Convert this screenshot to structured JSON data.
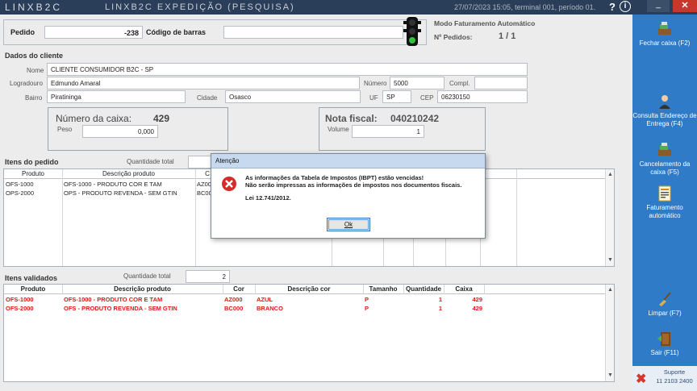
{
  "titlebar": {
    "brand": "LINXB2C",
    "title": "LINXB2C EXPEDIÇÃO (PESQUISA)",
    "status": "27/07/2023 15:05, terminal 001, período 01.",
    "help": "?",
    "info": "i",
    "minimize": "_",
    "close": "✕"
  },
  "header": {
    "pedido_label": "Pedido",
    "pedido_value": "-238",
    "codigo_label": "Código de barras",
    "codigo_value": "",
    "modo_label": "Modo Faturamento Automático",
    "npedidos_label": "Nº Pedidos:",
    "npedidos_value": "1 / 1"
  },
  "cliente": {
    "section": "Dados do cliente",
    "nome_label": "Nome",
    "nome_value": "CLIENTE CONSUMIDOR B2C - SP",
    "logradouro_label": "Logradouro",
    "logradouro_value": "Edmundo Amaral",
    "numero_label": "Número",
    "numero_value": "5000",
    "compl_label": "Compl.",
    "compl_value": "",
    "bairro_label": "Bairro",
    "bairro_value": "Piratininga",
    "cidade_label": "Cidade",
    "cidade_value": "Osasco",
    "uf_label": "UF",
    "uf_value": "SP",
    "cep_label": "CEP",
    "cep_value": "06230150"
  },
  "caixa": {
    "label": "Número da caixa:",
    "value": "429",
    "peso_label": "Peso",
    "peso_value": "0,000"
  },
  "nota": {
    "label": "Nota fiscal:",
    "value": "040210242",
    "volume_label": "Volume",
    "volume_value": "1"
  },
  "itens_pedido": {
    "section": "Itens do pedido",
    "qtd_label": "Quantidade total",
    "columns": [
      "Produto",
      "Descrição produto",
      "C"
    ],
    "rows": [
      {
        "produto": "OFS-1000",
        "descricao": "OFS-1000 - PRODUTO COR E TAM",
        "cor": "AZ000"
      },
      {
        "produto": "OPS-2000",
        "descricao": "OPS - PRODUTO REVENDA - SEM GTIN",
        "cor": "BC000"
      }
    ]
  },
  "itens_validados": {
    "section": "Itens validados",
    "qtd_label": "Quantidade total",
    "qtd_value": "2",
    "columns": [
      "Produto",
      "Descrição produto",
      "Cor",
      "Descrição cor",
      "Tamanho",
      "Quantidade",
      "Caixa"
    ],
    "rows": [
      {
        "produto": "OFS-1000",
        "descricao": "OFS-1000 - PRODUTO COR E TAM",
        "cor": "AZ000",
        "desc_cor": "AZUL",
        "tamanho": "P",
        "quantidade": "1",
        "caixa": "429"
      },
      {
        "produto": "OFS-2000",
        "descricao": "OFS - PRODUTO REVENDA - SEM GTIN",
        "cor": "BC000",
        "desc_cor": "BRANCO",
        "tamanho": "P",
        "quantidade": "1",
        "caixa": "429"
      }
    ]
  },
  "dialog": {
    "title": "Atenção",
    "line1": "As informações da Tabela de Impostos (IBPT) estão vencidas!",
    "line2": "Não serão impressas as informações de impostos nos documentos fiscais.",
    "line3": "Lei 12.741/2012.",
    "ok": "Ok"
  },
  "sidebar": {
    "fechar": "Fechar caixa (F2)",
    "consulta": "Consulta Endereço de Entrega (F4)",
    "cancelamento": "Cancelamento da caixa (F5)",
    "faturamento": "Faturamento automático",
    "limpar": "Limpar (F7)",
    "sair": "Sair (F11)",
    "suporte": "Suporte",
    "suporte_fone": "11 2103 2400"
  },
  "icons": {
    "traffic_light": "traffic-light-icon",
    "error": "error-icon",
    "fechar": "cash-register-icon",
    "consulta": "person-icon",
    "cancelamento": "cash-register-icon",
    "faturamento": "invoice-icon",
    "limpar": "broom-icon",
    "sair": "exit-door-icon",
    "suporte": "x-logo-icon"
  },
  "colors": {
    "sidebar": "#2f7bc8",
    "titlebar": "#2a3e59",
    "validated_text": "#e01818",
    "close_button": "#c8372b"
  }
}
